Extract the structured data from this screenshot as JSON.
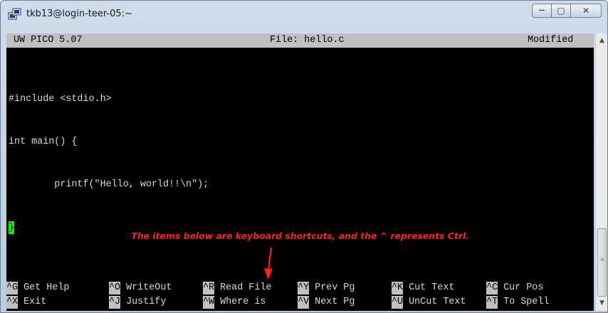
{
  "window": {
    "title": "tkb13@login-teer-05:~",
    "controls": {
      "minimize": "—",
      "maximize": "▢",
      "close": "✕"
    }
  },
  "pico": {
    "version": "UW PICO 5.07",
    "file": "File: hello.c",
    "status": "Modified"
  },
  "code_lines": [
    "#include <stdio.h>",
    "int main() {",
    "        printf(\"Hello, world!!\\n\");",
    "}"
  ],
  "annotation": "The items below are keyboard shortcuts, and the ^ represents Ctrl.",
  "shortcuts": [
    [
      {
        "key": "^G",
        "label": " Get Help"
      },
      {
        "key": "^O",
        "label": " WriteOut"
      },
      {
        "key": "^R",
        "label": " Read File"
      },
      {
        "key": "^Y",
        "label": " Prev Pg"
      },
      {
        "key": "^K",
        "label": " Cut Text"
      },
      {
        "key": "^C",
        "label": " Cur Pos"
      }
    ],
    [
      {
        "key": "^X",
        "label": " Exit"
      },
      {
        "key": "^J",
        "label": " Justify"
      },
      {
        "key": "^W",
        "label": " Where is"
      },
      {
        "key": "^V",
        "label": " Next Pg"
      },
      {
        "key": "^U",
        "label": " UnCut Text"
      },
      {
        "key": "^T",
        "label": " To Spell"
      }
    ]
  ],
  "colors": {
    "cursor": "#00ff00",
    "annotation": "#ff1f1f",
    "header_bg": "#c0c0c0"
  },
  "icons": {
    "app": "putty-icon",
    "scroll_up": "scroll-up-arrow-icon",
    "scroll_down": "scroll-down-arrow-icon",
    "annotation_arrow": "red-arrow-icon"
  }
}
